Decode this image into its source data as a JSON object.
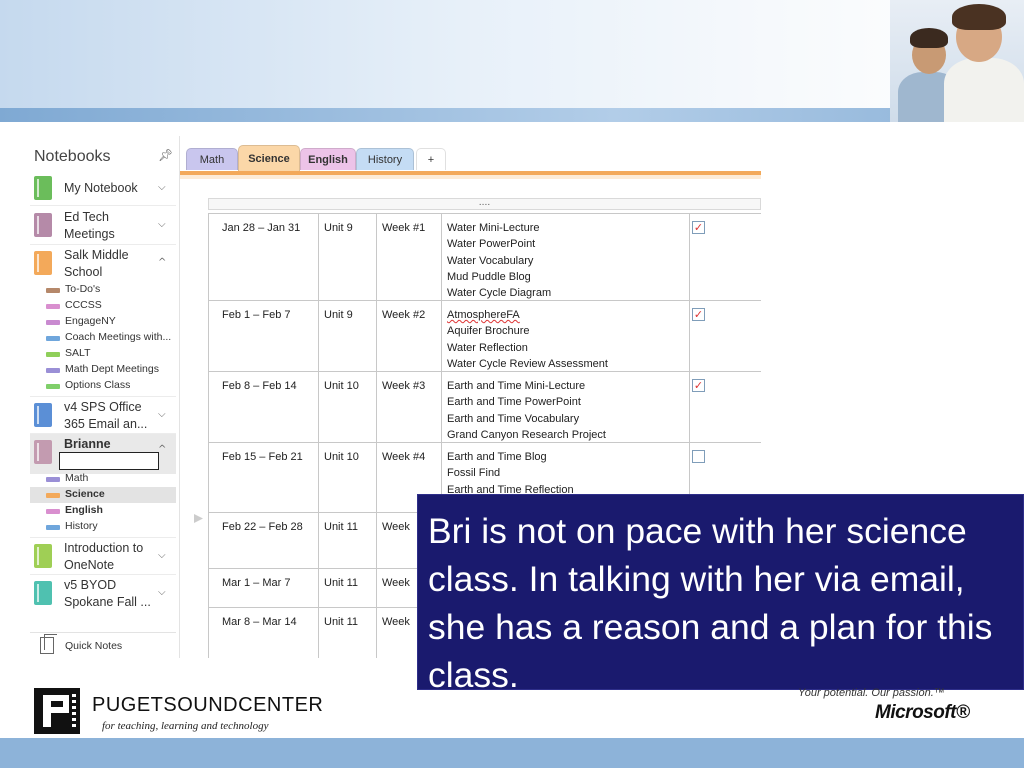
{
  "onenote": {
    "notebooks_title": "Notebooks",
    "notebooks": [
      {
        "name": "My Notebook",
        "color": "#6bbd5b"
      },
      {
        "name": "Ed Tech Meetings",
        "color": "#b58aa8"
      },
      {
        "name": "Salk Middle School",
        "color": "#f3a95a"
      },
      {
        "name": "v4 SPS Office 365 Email an...",
        "color": "#5b8fd6"
      },
      {
        "name": "Brianne",
        "color": "#c39bb0"
      },
      {
        "name": "Introduction to OneNote",
        "color": "#9fcf55"
      },
      {
        "name": "v5 BYOD Spokane Fall ...",
        "color": "#4fc1b0"
      }
    ],
    "salk_sections": [
      {
        "name": "To-Do's",
        "color": "#b5886a"
      },
      {
        "name": "CCCSS",
        "color": "#d98fcf"
      },
      {
        "name": "EngageNY",
        "color": "#c98ad0"
      },
      {
        "name": "Coach Meetings with...",
        "color": "#6fa6dc"
      },
      {
        "name": "SALT",
        "color": "#8fcf5a"
      },
      {
        "name": "Math Dept Meetings",
        "color": "#9a8fd6"
      },
      {
        "name": "Options Class",
        "color": "#7fcf6a"
      }
    ],
    "brianne_sections": [
      {
        "name": "Math",
        "color": "#9a8fd6"
      },
      {
        "name": "Science",
        "color": "#f3a95a"
      },
      {
        "name": "English",
        "color": "#d98fcf"
      },
      {
        "name": "History",
        "color": "#6fa6dc"
      }
    ],
    "quick_notes": "Quick Notes",
    "tabs": [
      {
        "label": "Math",
        "color": "#c9c6ee"
      },
      {
        "label": "Science",
        "color": "#fbd7a8"
      },
      {
        "label": "English",
        "color": "#ecc3e8"
      },
      {
        "label": "History",
        "color": "#c4dcf4"
      },
      {
        "label": "+",
        "color": "#ffffff"
      }
    ],
    "table_handle": "....",
    "rows": [
      {
        "dates": "Jan 28 – Jan 31",
        "unit": "Unit 9",
        "week": "Week #1",
        "items": [
          "Water Mini-Lecture",
          "Water PowerPoint",
          "Water Vocabulary",
          "Mud Puddle Blog",
          "Water Cycle Diagram"
        ],
        "check": "✓"
      },
      {
        "dates": "Feb 1 – Feb 7",
        "unit": "Unit 9",
        "week": "Week #2",
        "items": [
          "AtmosphereFA",
          "Aquifer Brochure",
          "Water Reflection",
          "Water Cycle Review Assessment"
        ],
        "check": "✓"
      },
      {
        "dates": "Feb 8 – Feb 14",
        "unit": "Unit 10",
        "week": "Week #3",
        "items": [
          "Earth and Time Mini-Lecture",
          "Earth and Time PowerPoint",
          "Earth and Time Vocabulary",
          "Grand Canyon Research Project"
        ],
        "check": "✓"
      },
      {
        "dates": "Feb 15 – Feb 21",
        "unit": "Unit 10",
        "week": "Week #4",
        "items": [
          "Earth and Time Blog",
          "Fossil Find",
          "Earth and Time Reflection"
        ],
        "check": ""
      },
      {
        "dates": "Feb 22 – Feb 28",
        "unit": "Unit 11",
        "week": "Week",
        "items": [],
        "check": ""
      },
      {
        "dates": "Mar 1 – Mar 7",
        "unit": "Unit 11",
        "week": "Week",
        "items": [],
        "check": ""
      },
      {
        "dates": "Mar 8 – Mar 14",
        "unit": "Unit 11",
        "week": "Week",
        "items": [],
        "check": ""
      }
    ]
  },
  "callout": {
    "text": "Bri is not on pace with her science class.  In talking with her via email, she has a reason and a plan for this class."
  },
  "footer": {
    "org_bold": "PUGETSOUND",
    "org_thin": "CENTER",
    "org_tagline": "for teaching, learning and technology",
    "ms_tagline": "Your potential. Our passion.™",
    "ms_logo": "Microsoft®"
  }
}
